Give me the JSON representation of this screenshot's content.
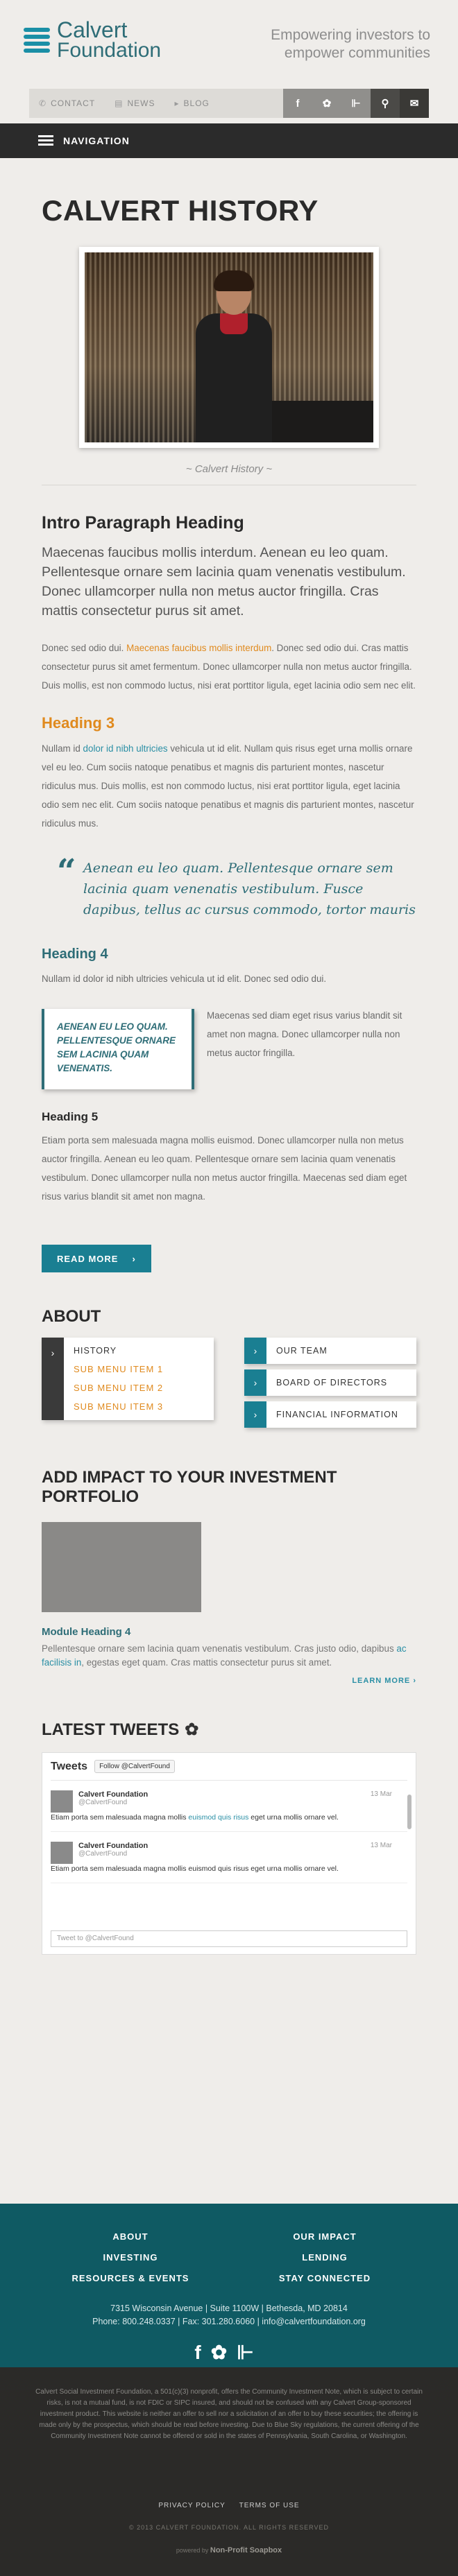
{
  "header": {
    "logo_line1": "Calvert",
    "logo_line2": "Foundation",
    "tagline_line1": "Empowering investors to",
    "tagline_line2": "empower communities"
  },
  "utility": {
    "links": [
      {
        "icon": "phone-icon",
        "label": "CONTACT"
      },
      {
        "icon": "news-icon",
        "label": "NEWS"
      },
      {
        "icon": "megaphone-icon",
        "label": "BLOG"
      }
    ],
    "buttons": [
      "facebook-icon",
      "twitter-icon",
      "rss-icon",
      "search-icon",
      "mail-icon"
    ]
  },
  "nav": {
    "label": "NAVIGATION"
  },
  "main": {
    "title": "CALVERT HISTORY",
    "caption": "~ Calvert History ~",
    "intro_heading": "Intro Paragraph Heading",
    "lead": "Maecenas faucibus mollis interdum. Aenean eu leo quam. Pellentesque ornare sem lacinia quam venenatis vestibulum. Donec ullamcorper nulla non metus auctor fringilla. Cras mattis consectetur purus sit amet.",
    "p1_a": "Donec sed odio dui. ",
    "p1_link": "Maecenas faucibus mollis interdum",
    "p1_b": ". Donec sed odio dui. Cras mattis consectetur purus sit amet fermentum. Donec ullamcorper nulla non metus auctor fringilla. Duis mollis, est non commodo luctus, nisi erat porttitor ligula, eget lacinia odio sem nec elit.",
    "heading3": "Heading 3",
    "p2_a": "Nullam id ",
    "p2_link": "dolor id nibh ultricies",
    "p2_b": " vehicula ut id elit. Nullam quis risus eget urna mollis ornare vel eu leo. Cum sociis natoque penatibus et magnis dis parturient montes, nascetur ridiculus mus. Duis mollis, est non commodo luctus, nisi erat porttitor ligula, eget lacinia odio sem nec elit. Cum sociis natoque penatibus et magnis dis parturient montes, nascetur ridiculus mus.",
    "quote": "Aenean eu leo quam. Pellentesque ornare sem lacinia quam venenatis vestibulum. Fusce dapibus, tellus ac cursus commodo, tortor mauris",
    "heading4": "Heading 4",
    "p3": "Nullam id dolor id nibh ultricies vehicula ut id elit. Donec sed odio dui.",
    "pullquote": "Aenean eu leo quam. Pellentesque ornare sem lacinia quam venenatis.",
    "pull_side": "Maecenas sed diam eget risus varius blandit sit amet non magna. Donec ullamcorper nulla non metus auctor fringilla.",
    "heading5": "Heading 5",
    "p4": "Etiam porta sem malesuada magna mollis euismod. Donec ullamcorper nulla non metus auctor fringilla. Aenean eu leo quam. Pellentesque ornare sem lacinia quam venenatis vestibulum. Donec ullamcorper nulla non metus auctor fringilla. Maecenas sed diam eget risus varius blandit sit amet non magna.",
    "read_more": "READ MORE"
  },
  "about": {
    "heading": "ABOUT",
    "history": "HISTORY",
    "sub_items": [
      "SUB MENU ITEM 1",
      "SUB MENU ITEM 2",
      "SUB MENU ITEM 3"
    ],
    "right_items": [
      "OUR TEAM",
      "BOARD OF DIRECTORS",
      "FINANCIAL INFORMATION"
    ]
  },
  "impact": {
    "heading": "ADD IMPACT TO YOUR INVESTMENT PORTFOLIO",
    "module_heading": "Module Heading 4",
    "module_a": "Pellentesque ornare sem lacinia quam venenatis vestibulum. Cras justo odio, dapibus ",
    "module_link": "ac facilisis in",
    "module_b": ", egestas eget quam. Cras mattis consectetur purus sit amet.",
    "learn_more": "LEARN MORE"
  },
  "tweets": {
    "heading": "LATEST TWEETS",
    "widget_title": "Tweets",
    "follow": "Follow @CalvertFound",
    "items": [
      {
        "name": "Calvert Foundation",
        "handle": "@CalvertFound",
        "date": "13 Mar",
        "text_a": "Etiam porta sem malesuada magna mollis ",
        "link": "euismod quis risus",
        "text_b": " eget urna mollis ornare vel."
      },
      {
        "name": "Calvert Foundation",
        "handle": "@CalvertFound",
        "date": "13 Mar",
        "text_a": "Etiam porta sem malesuada magna mollis euismod quis risus eget urna mollis ornare vel.",
        "link": "",
        "text_b": ""
      }
    ],
    "compose_placeholder": "Tweet to @CalvertFound"
  },
  "footer": {
    "links": [
      "ABOUT",
      "OUR IMPACT",
      "INVESTING",
      "LENDING",
      "RESOURCES & EVENTS",
      "STAY CONNECTED"
    ],
    "address": "7315 Wisconsin Avenue  |  Suite 1100W  |  Bethesda, MD 20814",
    "contact": "Phone: 800.248.0337  |  Fax: 301.280.6060  |  info@calvertfoundation.org",
    "social": [
      "f",
      "t",
      "rss"
    ]
  },
  "subfooter": {
    "disclaimer": "Calvert Social Investment Foundation, a 501(c)(3) nonprofit, offers the Community Investment Note, which is subject to certain risks, is not a mutual fund, is not FDIC or SIPC insured, and should not be confused with any Calvert Group-sponsored investment product. This website is neither an offer to sell nor a solicitation of an offer to buy these securities; the offering is made only by the prospectus, which should be read before investing. Due to Blue Sky regulations, the current offering of the Community Investment Note cannot be offered or sold in the states of Pennsylvania, South Carolina, or Washington.",
    "privacy": "PRIVACY POLICY",
    "terms": "TERMS OF USE",
    "copyright": "© 2013 CALVERT FOUNDATION. ALL RIGHTS RESERVED",
    "powered_by": "powered by",
    "powered_name": "Non-Profit Soapbox"
  }
}
